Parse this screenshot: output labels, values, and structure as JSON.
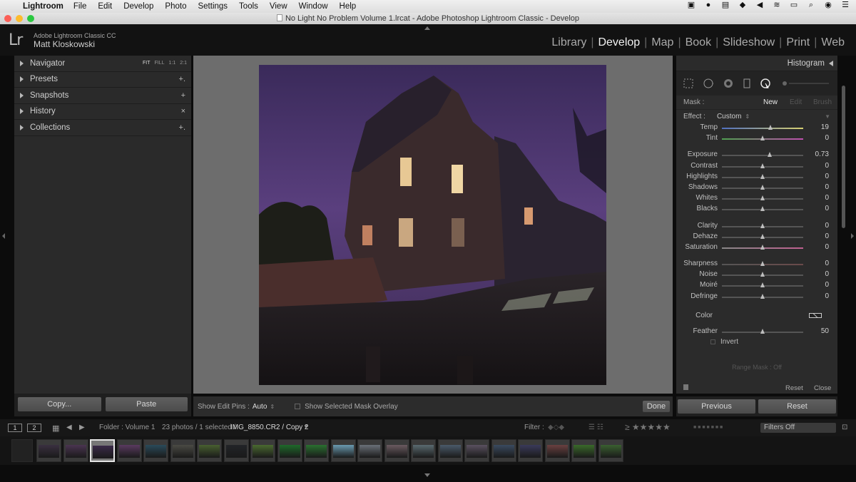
{
  "menubar": {
    "app": "Lightroom",
    "items": [
      "File",
      "Edit",
      "Develop",
      "Photo",
      "Settings",
      "Tools",
      "View",
      "Window",
      "Help"
    ]
  },
  "window": {
    "title": "No Light No Problem Volume 1.lrcat - Adobe Photoshop Lightroom Classic - Develop"
  },
  "identity": {
    "logo": "Lr",
    "product": "Adobe Lightroom Classic CC",
    "user": "Matt Kloskowski"
  },
  "modules": [
    {
      "label": "Library",
      "active": false
    },
    {
      "label": "Develop",
      "active": true
    },
    {
      "label": "Map",
      "active": false
    },
    {
      "label": "Book",
      "active": false
    },
    {
      "label": "Slideshow",
      "active": false
    },
    {
      "label": "Print",
      "active": false
    },
    {
      "label": "Web",
      "active": false
    }
  ],
  "left_panel": {
    "navigator": {
      "label": "Navigator",
      "zoom": [
        "FIT",
        "FILL",
        "1:1",
        "2:1"
      ]
    },
    "presets": {
      "label": "Presets",
      "action": "+."
    },
    "snapshots": {
      "label": "Snapshots",
      "action": "+"
    },
    "history": {
      "label": "History",
      "action": "×"
    },
    "collections": {
      "label": "Collections",
      "action": "+."
    },
    "copy_label": "Copy...",
    "paste_label": "Paste"
  },
  "toolbar": {
    "pins_label": "Show Edit Pins :",
    "pins_value": "Auto",
    "overlay_label": "Show Selected Mask Overlay",
    "done_label": "Done"
  },
  "right_panel": {
    "header": "Histogram",
    "mask_label": "Mask :",
    "mask_new": "New",
    "mask_edit": "Edit",
    "mask_brush": "Brush",
    "effect_label": "Effect :",
    "effect_value": "Custom",
    "sliders_group1": [
      {
        "label": "Temp",
        "value": "19",
        "pos": 0.6
      },
      {
        "label": "Tint",
        "value": "0",
        "pos": 0.5
      }
    ],
    "sliders_group2": [
      {
        "label": "Exposure",
        "value": "0.73",
        "pos": 0.59
      },
      {
        "label": "Contrast",
        "value": "0",
        "pos": 0.5
      },
      {
        "label": "Highlights",
        "value": "0",
        "pos": 0.5
      },
      {
        "label": "Shadows",
        "value": "0",
        "pos": 0.5
      },
      {
        "label": "Whites",
        "value": "0",
        "pos": 0.5
      },
      {
        "label": "Blacks",
        "value": "0",
        "pos": 0.5
      }
    ],
    "sliders_group3": [
      {
        "label": "Clarity",
        "value": "0",
        "pos": 0.5
      },
      {
        "label": "Dehaze",
        "value": "0",
        "pos": 0.5
      },
      {
        "label": "Saturation",
        "value": "0",
        "pos": 0.5
      }
    ],
    "sliders_group4": [
      {
        "label": "Sharpness",
        "value": "0",
        "pos": 0.5
      },
      {
        "label": "Noise",
        "value": "0",
        "pos": 0.5
      },
      {
        "label": "Moiré",
        "value": "0",
        "pos": 0.5
      },
      {
        "label": "Defringe",
        "value": "0",
        "pos": 0.5
      }
    ],
    "color_label": "Color",
    "feather": {
      "label": "Feather",
      "value": "50",
      "pos": 0.5
    },
    "invert_label": "Invert",
    "range_mask": "Range Mask : Off",
    "reset_label": "Reset",
    "close_label": "Close",
    "previous_label": "Previous",
    "reset_button_label": "Reset"
  },
  "filmstrip_bar": {
    "screen1": "1",
    "screen2": "2",
    "folder": "Folder : Volume 1",
    "count": "23 photos / 1 selected /",
    "filename": "IMG_8850.CR2 / Copy 2",
    "filter_label": "Filter :",
    "filters_off": "Filters Off"
  },
  "colors": {
    "accent": "#f2f2f2",
    "panel": "#2b2b2b",
    "background": "#0c0c0c"
  }
}
